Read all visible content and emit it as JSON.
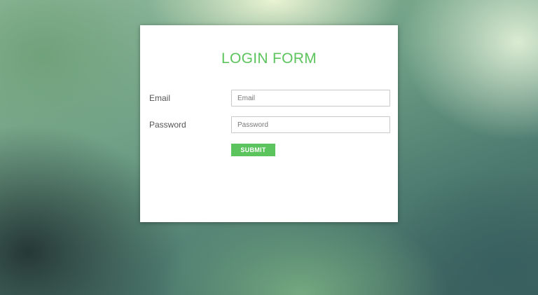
{
  "colors": {
    "accent": "#5cc45c",
    "card_background": "#ffffff",
    "label_text": "#555555",
    "input_border": "#c9c9c9"
  },
  "form": {
    "title": "LOGIN FORM",
    "email": {
      "label": "Email",
      "placeholder": "Email",
      "value": ""
    },
    "password": {
      "label": "Password",
      "placeholder": "Password",
      "value": ""
    },
    "submit_label": "SUBMIT"
  }
}
